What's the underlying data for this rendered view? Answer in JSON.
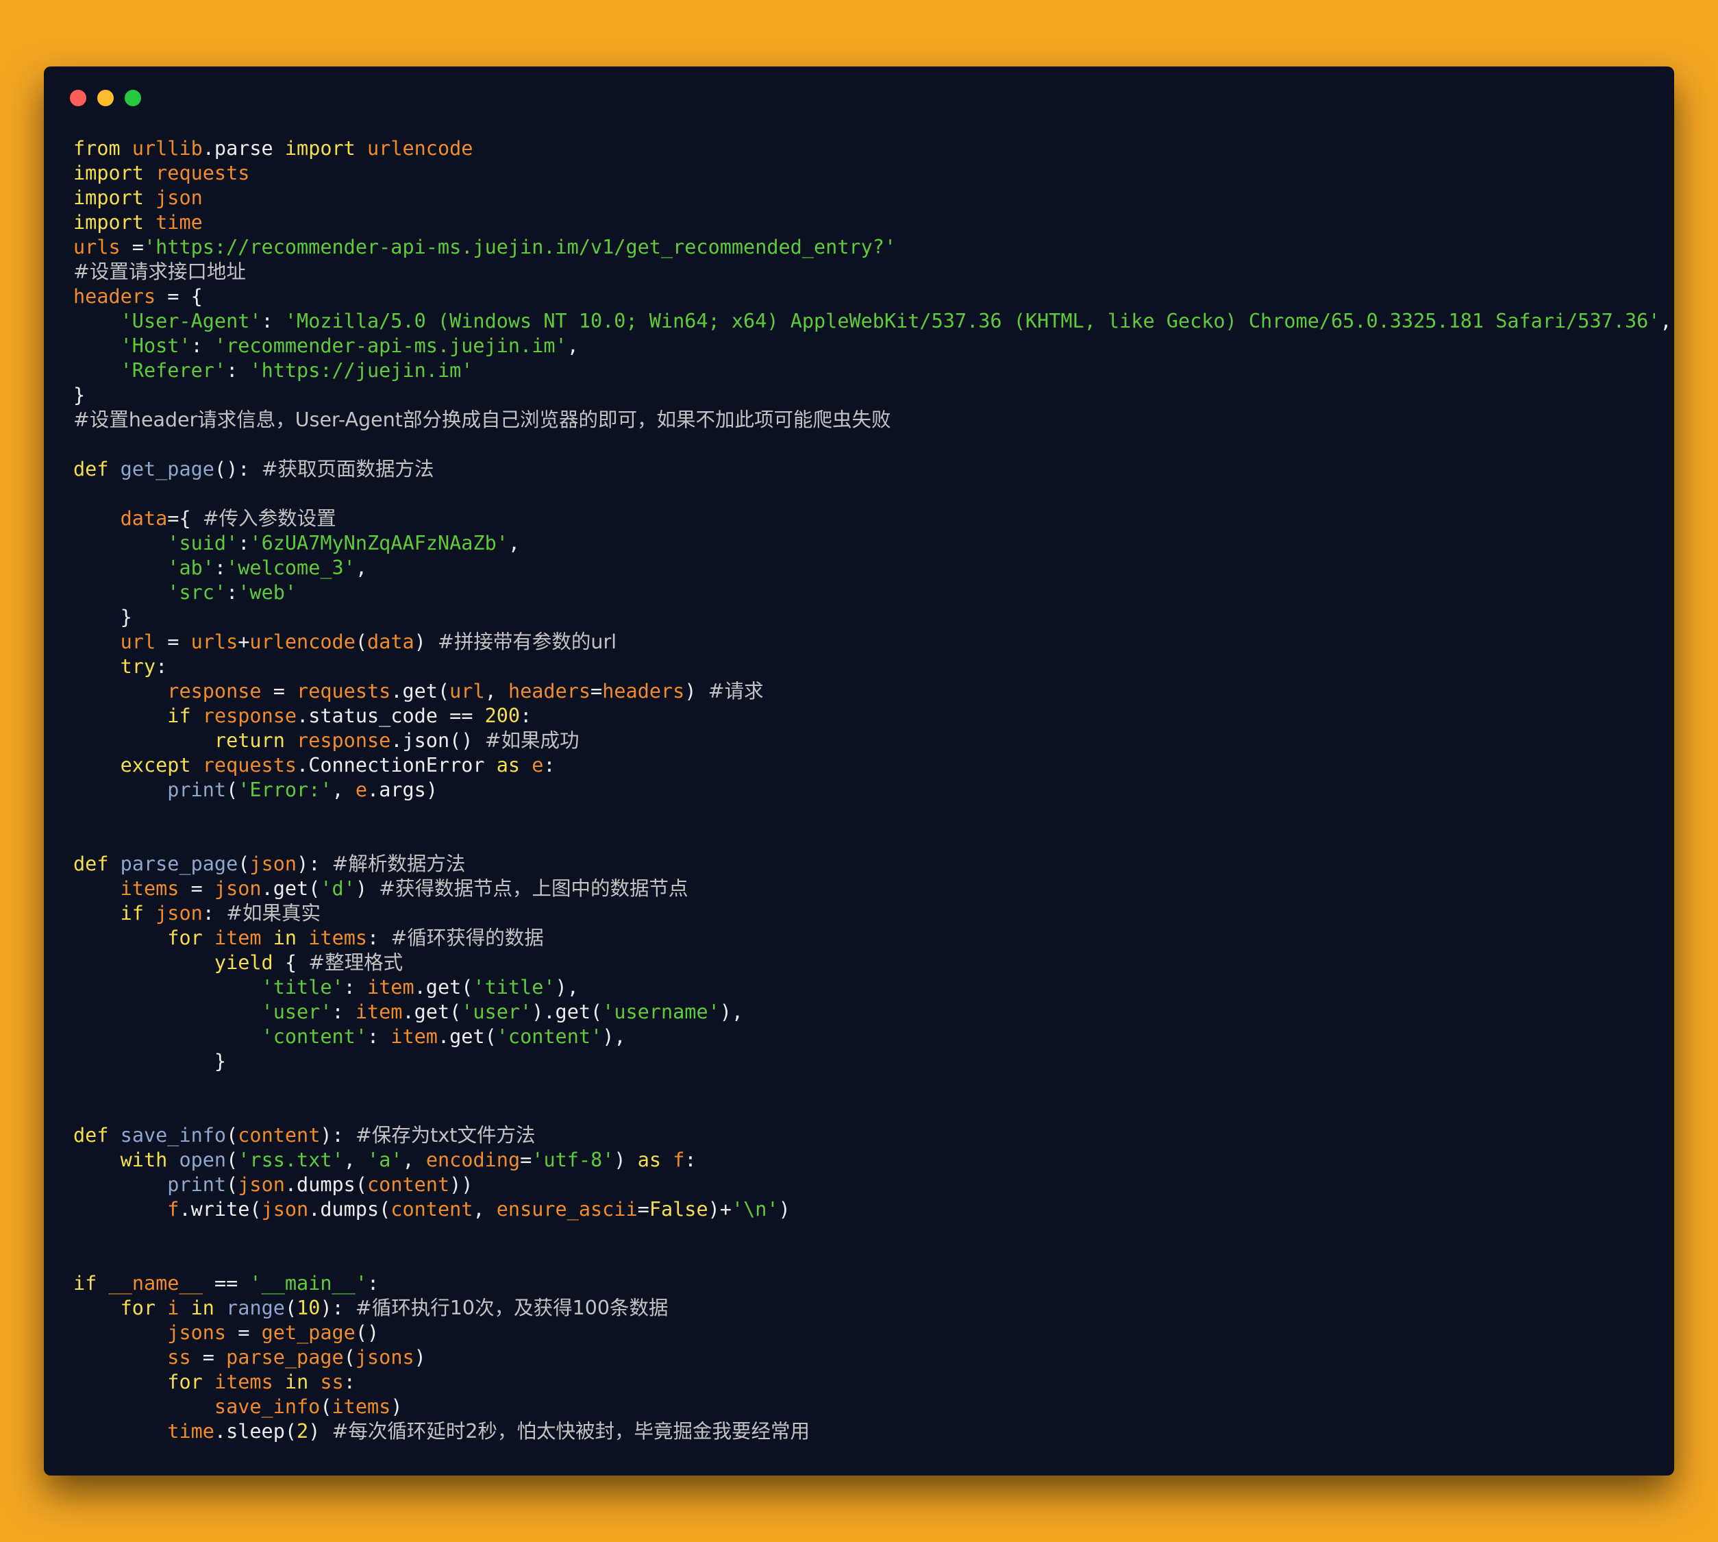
{
  "window": {
    "buttons": [
      "close",
      "minimize",
      "maximize"
    ],
    "colors": {
      "background": "#f4a623",
      "editor": "#0c1121",
      "close": "#ff5f56",
      "minimize": "#ffbd2e",
      "maximize": "#27c93f"
    }
  },
  "syntax_colors": {
    "keyword": "#f6df4f",
    "variable": "#f08c2c",
    "string": "#5ecb3c",
    "function": "#8fa6d0",
    "comment": "#c3c3c3",
    "number": "#f6df4f",
    "text": "#ededed"
  },
  "code": [
    [
      [
        "kw",
        "from"
      ],
      [
        "tx",
        " "
      ],
      [
        "vr",
        "urllib"
      ],
      [
        "tx",
        ".parse "
      ],
      [
        "kw",
        "import"
      ],
      [
        "tx",
        " "
      ],
      [
        "vr",
        "urlencode"
      ]
    ],
    [
      [
        "kw",
        "import"
      ],
      [
        "tx",
        " "
      ],
      [
        "vr",
        "requests"
      ]
    ],
    [
      [
        "kw",
        "import"
      ],
      [
        "tx",
        " "
      ],
      [
        "vr",
        "json"
      ]
    ],
    [
      [
        "kw",
        "import"
      ],
      [
        "tx",
        " "
      ],
      [
        "vr",
        "time"
      ]
    ],
    [
      [
        "vr",
        "urls"
      ],
      [
        "tx",
        " ="
      ],
      [
        "st",
        "'https://recommender-api-ms.juejin.im/v1/get_recommended_entry?'"
      ]
    ],
    [
      [
        "cm",
        "#设置请求接口地址"
      ]
    ],
    [
      [
        "vr",
        "headers"
      ],
      [
        "tx",
        " = {"
      ]
    ],
    [
      [
        "tx",
        "    "
      ],
      [
        "st",
        "'User-Agent'"
      ],
      [
        "tx",
        ": "
      ],
      [
        "st",
        "'Mozilla/5.0 (Windows NT 10.0; Win64; x64) AppleWebKit/537.36 (KHTML, like Gecko) Chrome/65.0.3325.181 Safari/537.36'"
      ],
      [
        "tx",
        ","
      ]
    ],
    [
      [
        "tx",
        "    "
      ],
      [
        "st",
        "'Host'"
      ],
      [
        "tx",
        ": "
      ],
      [
        "st",
        "'recommender-api-ms.juejin.im'"
      ],
      [
        "tx",
        ","
      ]
    ],
    [
      [
        "tx",
        "    "
      ],
      [
        "st",
        "'Referer'"
      ],
      [
        "tx",
        ": "
      ],
      [
        "st",
        "'https://juejin.im'"
      ]
    ],
    [
      [
        "tx",
        "}"
      ]
    ],
    [
      [
        "cm",
        "#设置header请求信息，User-Agent部分换成自己浏览器的即可，如果不加此项可能爬虫失败"
      ]
    ],
    [],
    [
      [
        "kw",
        "def"
      ],
      [
        "tx",
        " "
      ],
      [
        "fn",
        "get_page"
      ],
      [
        "tx",
        "(): "
      ],
      [
        "cm",
        "#获取页面数据方法"
      ]
    ],
    [],
    [
      [
        "tx",
        "    "
      ],
      [
        "vr",
        "data"
      ],
      [
        "tx",
        "={ "
      ],
      [
        "cm",
        "#传入参数设置"
      ]
    ],
    [
      [
        "tx",
        "        "
      ],
      [
        "st",
        "'suid'"
      ],
      [
        "tx",
        ":"
      ],
      [
        "st",
        "'6zUA7MyNnZqAAFzNAaZb'"
      ],
      [
        "tx",
        ","
      ]
    ],
    [
      [
        "tx",
        "        "
      ],
      [
        "st",
        "'ab'"
      ],
      [
        "tx",
        ":"
      ],
      [
        "st",
        "'welcome_3'"
      ],
      [
        "tx",
        ","
      ]
    ],
    [
      [
        "tx",
        "        "
      ],
      [
        "st",
        "'src'"
      ],
      [
        "tx",
        ":"
      ],
      [
        "st",
        "'web'"
      ]
    ],
    [
      [
        "tx",
        "    }"
      ]
    ],
    [
      [
        "tx",
        "    "
      ],
      [
        "vr",
        "url"
      ],
      [
        "tx",
        " = "
      ],
      [
        "vr",
        "urls"
      ],
      [
        "tx",
        "+"
      ],
      [
        "vr",
        "urlencode"
      ],
      [
        "tx",
        "("
      ],
      [
        "vr",
        "data"
      ],
      [
        "tx",
        ") "
      ],
      [
        "cm",
        "#拼接带有参数的url"
      ]
    ],
    [
      [
        "tx",
        "    "
      ],
      [
        "kw",
        "try"
      ],
      [
        "tx",
        ":"
      ]
    ],
    [
      [
        "tx",
        "        "
      ],
      [
        "vr",
        "response"
      ],
      [
        "tx",
        " = "
      ],
      [
        "vr",
        "requests"
      ],
      [
        "tx",
        ".get("
      ],
      [
        "vr",
        "url"
      ],
      [
        "tx",
        ", "
      ],
      [
        "vr",
        "headers"
      ],
      [
        "tx",
        "="
      ],
      [
        "vr",
        "headers"
      ],
      [
        "tx",
        ") "
      ],
      [
        "cm",
        "#请求"
      ]
    ],
    [
      [
        "tx",
        "        "
      ],
      [
        "kw",
        "if"
      ],
      [
        "tx",
        " "
      ],
      [
        "vr",
        "response"
      ],
      [
        "tx",
        ".status_code == "
      ],
      [
        "nm",
        "200"
      ],
      [
        "tx",
        ":"
      ]
    ],
    [
      [
        "tx",
        "            "
      ],
      [
        "kw",
        "return"
      ],
      [
        "tx",
        " "
      ],
      [
        "vr",
        "response"
      ],
      [
        "tx",
        ".json() "
      ],
      [
        "cm",
        "#如果成功"
      ]
    ],
    [
      [
        "tx",
        "    "
      ],
      [
        "kw",
        "except"
      ],
      [
        "tx",
        " "
      ],
      [
        "vr",
        "requests"
      ],
      [
        "tx",
        ".ConnectionError "
      ],
      [
        "kw",
        "as"
      ],
      [
        "tx",
        " "
      ],
      [
        "vr",
        "e"
      ],
      [
        "tx",
        ":"
      ]
    ],
    [
      [
        "tx",
        "        "
      ],
      [
        "fn",
        "print"
      ],
      [
        "tx",
        "("
      ],
      [
        "st",
        "'Error:'"
      ],
      [
        "tx",
        ", "
      ],
      [
        "vr",
        "e"
      ],
      [
        "tx",
        ".args)"
      ]
    ],
    [],
    [],
    [
      [
        "kw",
        "def"
      ],
      [
        "tx",
        " "
      ],
      [
        "fn",
        "parse_page"
      ],
      [
        "tx",
        "("
      ],
      [
        "vr",
        "json"
      ],
      [
        "tx",
        "): "
      ],
      [
        "cm",
        "#解析数据方法"
      ]
    ],
    [
      [
        "tx",
        "    "
      ],
      [
        "vr",
        "items"
      ],
      [
        "tx",
        " = "
      ],
      [
        "vr",
        "json"
      ],
      [
        "tx",
        ".get("
      ],
      [
        "st",
        "'d'"
      ],
      [
        "tx",
        ") "
      ],
      [
        "cm",
        "#获得数据节点，上图中的数据节点"
      ]
    ],
    [
      [
        "tx",
        "    "
      ],
      [
        "kw",
        "if"
      ],
      [
        "tx",
        " "
      ],
      [
        "vr",
        "json"
      ],
      [
        "tx",
        ": "
      ],
      [
        "cm",
        "#如果真实"
      ]
    ],
    [
      [
        "tx",
        "        "
      ],
      [
        "kw",
        "for"
      ],
      [
        "tx",
        " "
      ],
      [
        "vr",
        "item"
      ],
      [
        "tx",
        " "
      ],
      [
        "kw",
        "in"
      ],
      [
        "tx",
        " "
      ],
      [
        "vr",
        "items"
      ],
      [
        "tx",
        ": "
      ],
      [
        "cm",
        "#循环获得的数据"
      ]
    ],
    [
      [
        "tx",
        "            "
      ],
      [
        "kw",
        "yield"
      ],
      [
        "tx",
        " { "
      ],
      [
        "cm",
        "#整理格式"
      ]
    ],
    [
      [
        "tx",
        "                "
      ],
      [
        "st",
        "'title'"
      ],
      [
        "tx",
        ": "
      ],
      [
        "vr",
        "item"
      ],
      [
        "tx",
        ".get("
      ],
      [
        "st",
        "'title'"
      ],
      [
        "tx",
        "),"
      ]
    ],
    [
      [
        "tx",
        "                "
      ],
      [
        "st",
        "'user'"
      ],
      [
        "tx",
        ": "
      ],
      [
        "vr",
        "item"
      ],
      [
        "tx",
        ".get("
      ],
      [
        "st",
        "'user'"
      ],
      [
        "tx",
        ").get("
      ],
      [
        "st",
        "'username'"
      ],
      [
        "tx",
        "),"
      ]
    ],
    [
      [
        "tx",
        "                "
      ],
      [
        "st",
        "'content'"
      ],
      [
        "tx",
        ": "
      ],
      [
        "vr",
        "item"
      ],
      [
        "tx",
        ".get("
      ],
      [
        "st",
        "'content'"
      ],
      [
        "tx",
        "),"
      ]
    ],
    [
      [
        "tx",
        "            }"
      ]
    ],
    [],
    [],
    [
      [
        "kw",
        "def"
      ],
      [
        "tx",
        " "
      ],
      [
        "fn",
        "save_info"
      ],
      [
        "tx",
        "("
      ],
      [
        "vr",
        "content"
      ],
      [
        "tx",
        "): "
      ],
      [
        "cm",
        "#保存为txt文件方法"
      ]
    ],
    [
      [
        "tx",
        "    "
      ],
      [
        "kw",
        "with"
      ],
      [
        "tx",
        " "
      ],
      [
        "fn",
        "open"
      ],
      [
        "tx",
        "("
      ],
      [
        "st",
        "'rss.txt'"
      ],
      [
        "tx",
        ", "
      ],
      [
        "st",
        "'a'"
      ],
      [
        "tx",
        ", "
      ],
      [
        "vr",
        "encoding"
      ],
      [
        "tx",
        "="
      ],
      [
        "st",
        "'utf-8'"
      ],
      [
        "tx",
        ") "
      ],
      [
        "kw",
        "as"
      ],
      [
        "tx",
        " "
      ],
      [
        "vr",
        "f"
      ],
      [
        "tx",
        ":"
      ]
    ],
    [
      [
        "tx",
        "        "
      ],
      [
        "fn",
        "print"
      ],
      [
        "tx",
        "("
      ],
      [
        "vr",
        "json"
      ],
      [
        "tx",
        ".dumps("
      ],
      [
        "vr",
        "content"
      ],
      [
        "tx",
        "))"
      ]
    ],
    [
      [
        "tx",
        "        "
      ],
      [
        "vr",
        "f"
      ],
      [
        "tx",
        ".write("
      ],
      [
        "vr",
        "json"
      ],
      [
        "tx",
        ".dumps("
      ],
      [
        "vr",
        "content"
      ],
      [
        "tx",
        ", "
      ],
      [
        "vr",
        "ensure_ascii"
      ],
      [
        "tx",
        "="
      ],
      [
        "kw",
        "False"
      ],
      [
        "tx",
        ")+"
      ],
      [
        "st",
        "'\\n'"
      ],
      [
        "tx",
        ")"
      ]
    ],
    [],
    [],
    [
      [
        "kw",
        "if"
      ],
      [
        "tx",
        " "
      ],
      [
        "vr",
        "__name__"
      ],
      [
        "tx",
        " == "
      ],
      [
        "st",
        "'__main__'"
      ],
      [
        "tx",
        ":"
      ]
    ],
    [
      [
        "tx",
        "    "
      ],
      [
        "kw",
        "for"
      ],
      [
        "tx",
        " "
      ],
      [
        "vr",
        "i"
      ],
      [
        "tx",
        " "
      ],
      [
        "kw",
        "in"
      ],
      [
        "tx",
        " "
      ],
      [
        "fn",
        "range"
      ],
      [
        "tx",
        "("
      ],
      [
        "nm",
        "10"
      ],
      [
        "tx",
        "): "
      ],
      [
        "cm",
        "#循环执行10次，及获得100条数据"
      ]
    ],
    [
      [
        "tx",
        "        "
      ],
      [
        "vr",
        "jsons"
      ],
      [
        "tx",
        " = "
      ],
      [
        "vr",
        "get_page"
      ],
      [
        "tx",
        "()"
      ]
    ],
    [
      [
        "tx",
        "        "
      ],
      [
        "vr",
        "ss"
      ],
      [
        "tx",
        " = "
      ],
      [
        "vr",
        "parse_page"
      ],
      [
        "tx",
        "("
      ],
      [
        "vr",
        "jsons"
      ],
      [
        "tx",
        ")"
      ]
    ],
    [
      [
        "tx",
        "        "
      ],
      [
        "kw",
        "for"
      ],
      [
        "tx",
        " "
      ],
      [
        "vr",
        "items"
      ],
      [
        "tx",
        " "
      ],
      [
        "kw",
        "in"
      ],
      [
        "tx",
        " "
      ],
      [
        "vr",
        "ss"
      ],
      [
        "tx",
        ":"
      ]
    ],
    [
      [
        "tx",
        "            "
      ],
      [
        "vr",
        "save_info"
      ],
      [
        "tx",
        "("
      ],
      [
        "vr",
        "items"
      ],
      [
        "tx",
        ")"
      ]
    ],
    [
      [
        "tx",
        "        "
      ],
      [
        "vr",
        "time"
      ],
      [
        "tx",
        ".sleep("
      ],
      [
        "nm",
        "2"
      ],
      [
        "tx",
        ") "
      ],
      [
        "cm",
        "#每次循环延时2秒，怕太快被封，毕竟掘金我要经常用"
      ]
    ]
  ]
}
